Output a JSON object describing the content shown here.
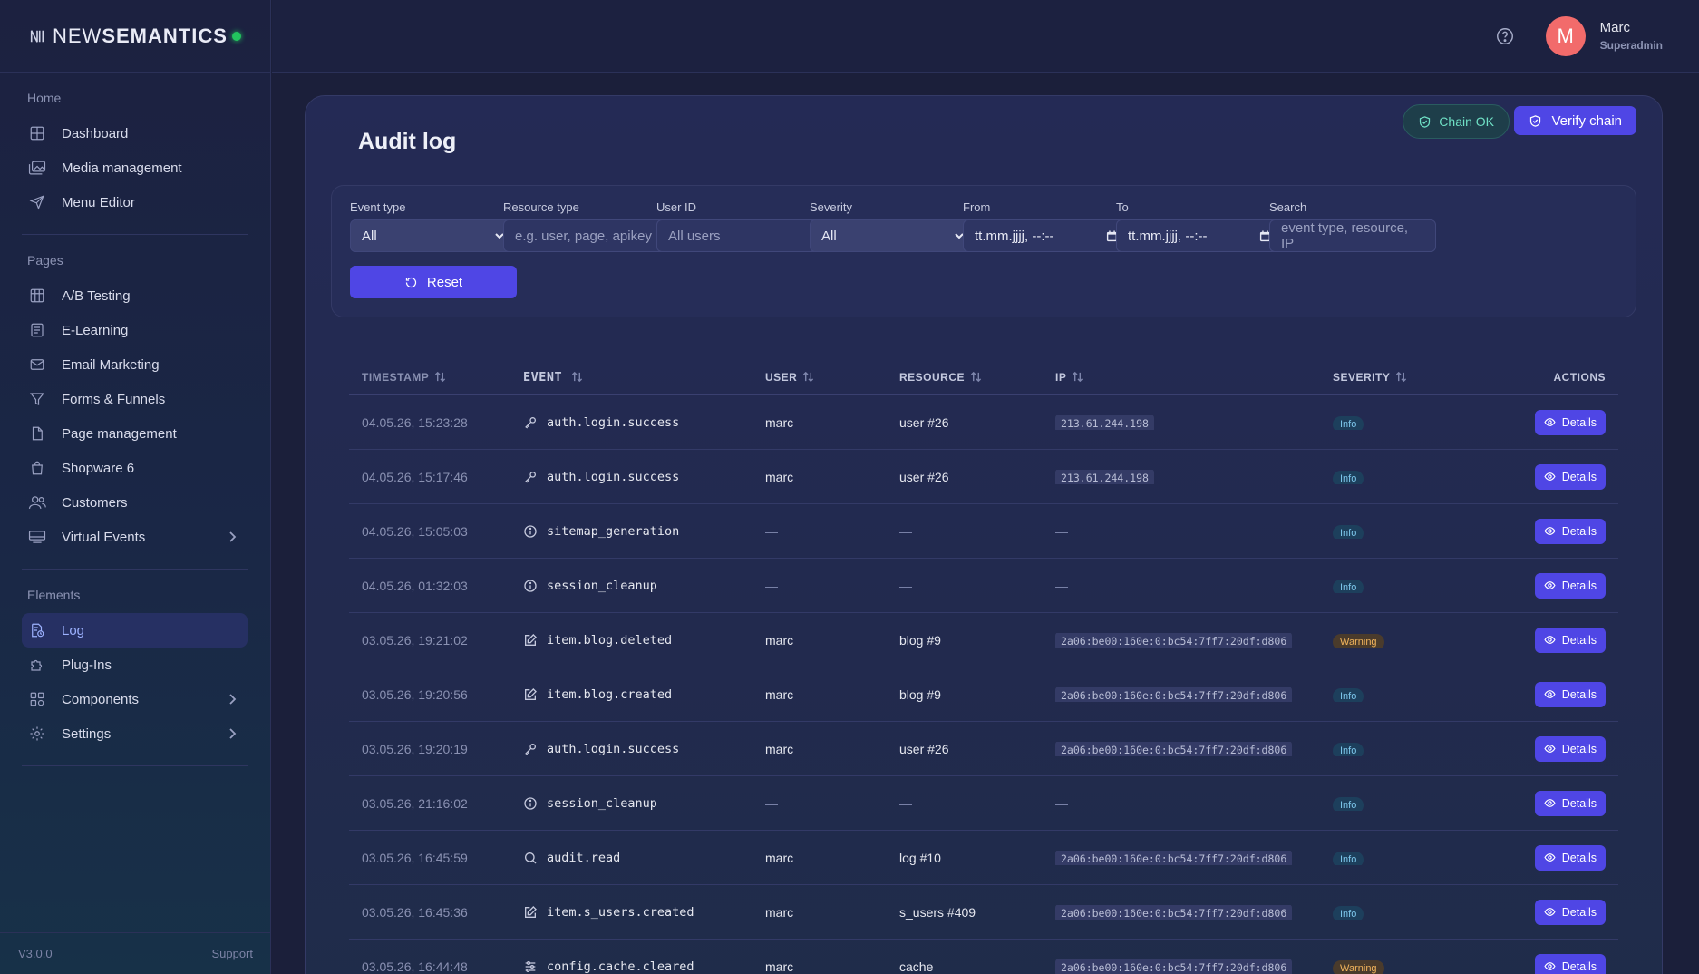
{
  "brand": {
    "name_light": "NEW",
    "name_bold": "SEMANTICS"
  },
  "sidebar": {
    "sections": [
      {
        "heading": "Home",
        "items": [
          {
            "label": "Dashboard",
            "icon": "grid-icon"
          },
          {
            "label": "Media management",
            "icon": "images-icon"
          },
          {
            "label": "Menu Editor",
            "icon": "send-icon"
          }
        ]
      },
      {
        "heading": "Pages",
        "items": [
          {
            "label": "A/B Testing",
            "icon": "columns-icon"
          },
          {
            "label": "E-Learning",
            "icon": "document-icon"
          },
          {
            "label": "Email Marketing",
            "icon": "mail-icon"
          },
          {
            "label": "Forms & Funnels",
            "icon": "funnel-icon"
          },
          {
            "label": "Page management",
            "icon": "file-icon"
          },
          {
            "label": "Shopware 6",
            "icon": "shopping-bag-icon"
          },
          {
            "label": "Customers",
            "icon": "users-icon"
          },
          {
            "label": "Virtual Events",
            "icon": "monitor-icon",
            "has_chevron": true
          }
        ]
      },
      {
        "heading": "Elements",
        "items": [
          {
            "label": "Log",
            "icon": "log-icon",
            "active": true
          },
          {
            "label": "Plug-Ins",
            "icon": "puzzle-icon"
          },
          {
            "label": "Components",
            "icon": "components-icon",
            "has_chevron": true
          },
          {
            "label": "Settings",
            "icon": "gear-icon",
            "has_chevron": true
          }
        ]
      }
    ],
    "footer": {
      "version": "V3.0.0",
      "support": "Support"
    }
  },
  "topbar": {
    "user_initial": "M",
    "user_name": "Marc",
    "user_role": "Superadmin"
  },
  "page": {
    "title": "Audit log",
    "chain_ok_label": "Chain OK",
    "verify_label": "Verify chain"
  },
  "filters": {
    "event_type": {
      "label": "Event type",
      "value": "All"
    },
    "resource_type": {
      "label": "Resource type",
      "placeholder": "e.g. user, page, apikey"
    },
    "user_id": {
      "label": "User ID",
      "placeholder": "All users"
    },
    "severity": {
      "label": "Severity",
      "value": "All"
    },
    "from": {
      "label": "From",
      "value": "tt.mm.jjjj, --:--"
    },
    "to": {
      "label": "To",
      "value": "tt.mm.jjjj, --:--"
    },
    "search": {
      "label": "Search",
      "placeholder": "event type, resource, IP"
    },
    "reset_label": "Reset"
  },
  "table": {
    "columns": [
      "TIMESTAMP",
      "EVENT",
      "USER",
      "RESOURCE",
      "IP",
      "SEVERITY",
      "ACTIONS"
    ],
    "details_label": "Details",
    "rows": [
      {
        "timestamp": "04.05.26, 15:23:28",
        "event": "auth.login.success",
        "icon": "key-icon",
        "user": "marc",
        "resource": "user #26",
        "ip": "213.61.244.198",
        "severity": "Info"
      },
      {
        "timestamp": "04.05.26, 15:17:46",
        "event": "auth.login.success",
        "icon": "key-icon",
        "user": "marc",
        "resource": "user #26",
        "ip": "213.61.244.198",
        "severity": "Info"
      },
      {
        "timestamp": "04.05.26, 15:05:03",
        "event": "sitemap_generation",
        "icon": "info-icon",
        "user": "—",
        "resource": "—",
        "ip": "—",
        "severity": "Info"
      },
      {
        "timestamp": "04.05.26, 01:32:03",
        "event": "session_cleanup",
        "icon": "info-icon",
        "user": "—",
        "resource": "—",
        "ip": "—",
        "severity": "Info"
      },
      {
        "timestamp": "03.05.26, 19:21:02",
        "event": "item.blog.deleted",
        "icon": "edit-icon",
        "user": "marc",
        "resource": "blog #9",
        "ip": "2a06:be00:160e:0:bc54:7ff7:20df:d806",
        "severity": "Warning"
      },
      {
        "timestamp": "03.05.26, 19:20:56",
        "event": "item.blog.created",
        "icon": "edit-icon",
        "user": "marc",
        "resource": "blog #9",
        "ip": "2a06:be00:160e:0:bc54:7ff7:20df:d806",
        "severity": "Info"
      },
      {
        "timestamp": "03.05.26, 19:20:19",
        "event": "auth.login.success",
        "icon": "key-icon",
        "user": "marc",
        "resource": "user #26",
        "ip": "2a06:be00:160e:0:bc54:7ff7:20df:d806",
        "severity": "Info"
      },
      {
        "timestamp": "03.05.26, 21:16:02",
        "event": "session_cleanup",
        "icon": "info-icon",
        "user": "—",
        "resource": "—",
        "ip": "—",
        "severity": "Info"
      },
      {
        "timestamp": "03.05.26, 16:45:59",
        "event": "audit.read",
        "icon": "search-icon",
        "user": "marc",
        "resource": "log #10",
        "ip": "2a06:be00:160e:0:bc54:7ff7:20df:d806",
        "severity": "Info"
      },
      {
        "timestamp": "03.05.26, 16:45:36",
        "event": "item.s_users.created",
        "icon": "edit-icon",
        "user": "marc",
        "resource": "s_users #409",
        "ip": "2a06:be00:160e:0:bc54:7ff7:20df:d806",
        "severity": "Info"
      },
      {
        "timestamp": "03.05.26, 16:44:48",
        "event": "config.cache.cleared",
        "icon": "sliders-icon",
        "user": "marc",
        "resource": "cache",
        "ip": "2a06:be00:160e:0:bc54:7ff7:20df:d806",
        "severity": "Warning"
      }
    ]
  },
  "colors": {
    "accent": "#4f46e5",
    "status_dot": "#22c55e",
    "avatar": "#f26b6b"
  }
}
